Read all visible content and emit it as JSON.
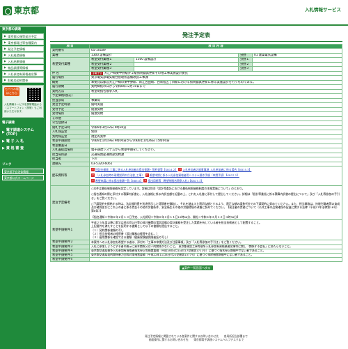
{
  "header": {
    "logo_text": "東京都",
    "system_name": "入札情報サービス"
  },
  "sidebar": {
    "head1": "東京都の調達",
    "items": [
      "東京都公報等発注予定",
      "東京都発注等各種案内",
      "発注予定情報",
      "入札経過情報",
      "入札結果情報",
      "物品調達等情報",
      "入札参加有資格者名簿",
      "財務局契約関係"
    ],
    "mobile": {
      "badge": "モバイル版はこちら",
      "text": "入札情報サービスを携帯電話から（スマートフォン・携帯）もご利用いただけます。"
    },
    "head2": "電子調達",
    "sub": [
      {
        "label": "電子調達システム(TOP)"
      },
      {
        "label": "電 子 入 札"
      },
      {
        "label": "資 格 審 査"
      }
    ],
    "head3": "リンク",
    "ext": [
      "東京都下自治体情報",
      "東京都公式ホームページ"
    ]
  },
  "main": {
    "title": "発注予定表",
    "col_item": "項 目",
    "col_content": "項 目 内 容",
    "row_no": {
      "label": "契約番号",
      "value": "05-10189"
    },
    "row_gyoshu": {
      "label": "業種",
      "value": "1300 設備設計",
      "cat_label": "分野",
      "cat_value": "01 建築電気設備"
    },
    "row_kibou": {
      "label": "希望受付業種",
      "r1a": "希望受付業種１",
      "r1b": "1300 設備設計",
      "r2a": "希望受付業種２",
      "r3a": "希望受付業種３",
      "cat2": "分野２",
      "cat3": "分野３",
      "cat1": "分野１"
    },
    "row_kenmei": {
      "label": "件 名",
      "prefix": "【電子】",
      "value": "大江戸線東中野駅外２駅照明器具更新その他工事実施設計委託"
    },
    "row_basho": {
      "label": "履行場所",
      "value": "東京電気部電気総合管理所設備改良工事課"
    },
    "row_gaiyou": {
      "label": "概要",
      "value": "本委託は都営大江戸線の東中野駅、新江古田駅、西新宿五丁目駅における照明器具更新に係る実施設計を行うものである。"
    },
    "row_kikan": {
      "label": "履行期間",
      "value": "契約締結の日から令和8年12月10日まで"
    },
    "row_houshiki": {
      "label": "契約方法",
      "value": "希望制指名競争入札"
    },
    "row_yoteikakaku": {
      "label": "予定価格(税込)",
      "value": ""
    },
    "row_kanri": {
      "label": "担当部局",
      "value": "事業局"
    },
    "row_kikan2": {
      "label": "発注予定時期",
      "value": "随時実施"
    },
    "row_jyuchu": {
      "label": "受付予定",
      "value": "随意契約"
    },
    "row_uketsuke": {
      "label": "受付場所",
      "value": "随意契約"
    },
    "row_sonota": {
      "label": "その他",
      "value": ""
    },
    "row_kouji": {
      "label": "公告登録日",
      "value": ""
    },
    "row_jyuri": {
      "label": "開札予定日時",
      "value": "令和6年3月12日 9時30分"
    },
    "row_hoshou": {
      "label": "入札保証金",
      "value": "免除"
    },
    "row_keiyaku": {
      "label": "契約保証金",
      "value": "規定的案件"
    },
    "row_shinsei": {
      "label": "希望申請期間",
      "value": "令和6年1月19日 9時00分から令和6年1月26日 15時00分"
    },
    "row_shinsahaku": {
      "label": "希望審査日",
      "value": ""
    },
    "row_nyusatsu": {
      "label": "入札書提出場所",
      "value": "電子調達システムから希望申請をしてください。"
    },
    "row_tantoka": {
      "label": "担当局所部",
      "value": "交通局資産運用部契約課"
    },
    "row_tantousha": {
      "label": "担当者",
      "value": "下川"
    },
    "row_renraku": {
      "label": "連絡先",
      "value": "03-5320-6061"
    },
    "row_haifu": {
      "label": "配布資料等",
      "links": [
        "特記仕様書_工事に係る入札参加者の提出書類・誓約書等【KB14.2】",
        "入札参加者の留意事項_入札参加者に係る場合【KB15.3】",
        "（入札参加時の現場説明の方法書_工事）",
        "希望申請に係る入札参加資格者用システム操作手順（申請手続）【KB37.2】",
        "希望申請に係る提出書類一覧【KB5.0】",
        "提出用紙等（希望制指名競争入札)【KB17.7】"
      ]
    },
    "row_yotei": {
      "label": "発注予定備考",
      "lines": [
        "○本件は最低制限価格を設定しています。詳細は別添「設計等委託における最低制限価格制度の本格実施について」のとおり。",
        "○指名通知の際に添付する積算内訳書に、入札価格に係る内訳金額を記載の上、これを入札書に添付して提出してください。詳細は「設計等委託に係る積算内訳書の提出について」及び「入札等参加の手引き」をご覧ください。",
        "○下請契約を締結する時は、法定福利費を別途明示した見積書を徴取し、それを踏まえた適切な額とするよう、適正な額の請負代金での下請契約に努めてください。また、担当業務は、技能労働者等の育成及び確保並びにこれらの者に係る賃金その他の労働条件、安全衛生その他の労働環境の改善に努めてください。【発注者の責務について（公共工事の品質確保の促進に関する法律（平成17年法律第18号）第8条）】",
        "【指名通知＝令和６年２月１３日予定、入札締切＝令和６年３月１１日15時00分、開札＝令和６年３月１２日 9時30分】"
      ]
    },
    "row_j1": {
      "label": "希望申請要件１",
      "lines": [
        "平成２５年度以降に都又は他の官公庁等の発注機関の電気設備の設計業務を受注した実績を有している者を担当技術者として配置すること。",
        "上記要件を満たすことを証明する書類として以下の書類を提出すること。",
        "（１）契約関係書類の写し",
        "（２）担当技術者の経歴書（設計業務の経歴を含む。）",
        "（３）雇用関係を確認できる書類（健康保険被保険者証の写し）"
      ]
    },
    "row_j2": {
      "label": "希望申請要件２",
      "value": "本案件への入札参加を希望する者は、添付の「工事の申請方法及び注意事項」及び「入札等参加の手引き」をご覧ください。"
    },
    "row_j3": {
      "label": "希望申請要件３",
      "value": "入札に参加しようとする者の開示に資本関係又は人的関係がないこと。 東京都建設工事等競争入札参加有資格業者名簿等に関し「関係する会社」にあたらないこと。"
    },
    "row_j4": {
      "label": "希望申請要件４",
      "value": "東京都交通局競争入札参加有資格者指名停止等措置要綱（平成18年4月1日付17交総第1711号）に基づく指名停止期間中でない者であること。"
    },
    "row_j5": {
      "label": "希望申請要件５",
      "value": "東京都交通局契約関係暴力団等対策措置要綱（平成22年11月8日付22交総第1377号）に基づく排除措置期間中にない者であること。"
    },
    "row_j6": {
      "label": "希望申請要件６",
      "value": ""
    },
    "back": "▲案件一覧画面へ戻る"
  },
  "footer": {
    "line1": "発注予定情報に掲載されている各案件に関するお問い合わせ先　　各局所担当部署まで",
    "line2": "画面操作に関するお問い合わせ先　　東京都電子調達システムヘルプデスクまで"
  }
}
